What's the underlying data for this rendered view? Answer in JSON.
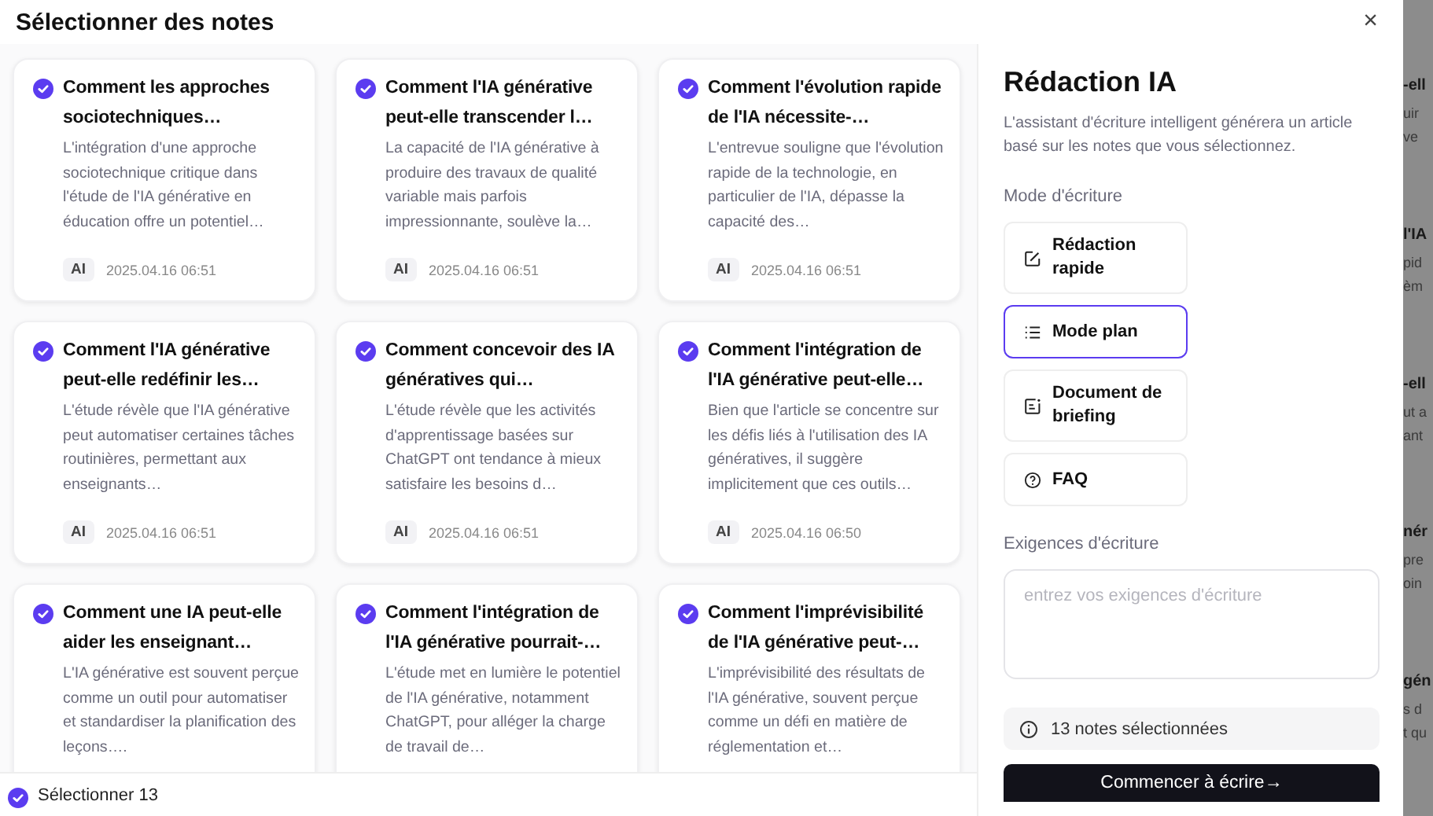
{
  "dialog": {
    "title": "Sélectionner des notes",
    "close": "×"
  },
  "notes": [
    {
      "selected": true,
      "title": "Comment les approches sociotechniques…",
      "summary": "L'intégration d'une approche sociotechnique critique dans l'étude de l'IA générative en éducation offre un potentiel…",
      "tag": "AI",
      "date": "2025.04.16 06:51"
    },
    {
      "selected": true,
      "title": "Comment l'IA générative peut-elle transcender l…",
      "summary": "La capacité de l'IA générative à produire des travaux de qualité variable mais parfois impressionnante, soulève la…",
      "tag": "AI",
      "date": "2025.04.16 06:51"
    },
    {
      "selected": true,
      "title": "Comment l'évolution rapide de l'IA nécessite-…",
      "summary": "L'entrevue souligne que l'évolution rapide de la technologie, en particulier de l'IA, dépasse la capacité des…",
      "tag": "AI",
      "date": "2025.04.16 06:51"
    },
    {
      "selected": true,
      "title": "Comment l'IA générative peut-elle redéfinir les…",
      "summary": "L'étude révèle que l'IA générative peut automatiser certaines tâches routinières, permettant aux enseignants…",
      "tag": "AI",
      "date": "2025.04.16 06:51"
    },
    {
      "selected": true,
      "title": "Comment concevoir des IA génératives qui…",
      "summary": "L'étude révèle que les activités d'apprentissage basées sur ChatGPT ont tendance à mieux satisfaire les besoins d…",
      "tag": "AI",
      "date": "2025.04.16 06:51"
    },
    {
      "selected": true,
      "title": "Comment l'intégration de l'IA générative peut-elle…",
      "summary": "Bien que l'article se concentre sur les défis liés à l'utilisation des IA génératives, il suggère implicitement que ces outils…",
      "tag": "AI",
      "date": "2025.04.16 06:50"
    },
    {
      "selected": true,
      "title": "Comment une IA peut-elle aider les enseignant…",
      "summary": "L'IA générative est souvent perçue comme un outil pour automatiser et standardiser la planification des leçons…."
    },
    {
      "selected": true,
      "title": "Comment l'intégration de l'IA générative pourrait-…",
      "summary": "L'étude met en lumière le potentiel de l'IA générative, notamment ChatGPT, pour alléger la charge de travail de…"
    },
    {
      "selected": true,
      "title": "Comment l'imprévisibilité de l'IA générative peut-…",
      "summary": "L'imprévisibilité des résultats de l'IA générative, souvent perçue comme un défi en matière de réglementation et…"
    }
  ],
  "footer": {
    "select_all": {
      "checked": true,
      "label": "Sélectionner 13"
    }
  },
  "panel": {
    "title": "Rédaction IA",
    "description": "L'assistant d'écriture intelligent générera un article basé sur les notes que vous sélectionnez.",
    "mode_label": "Mode d'écriture",
    "modes": [
      {
        "kind": "quick",
        "label": "Rédaction rapide",
        "selected": false
      },
      {
        "kind": "outline",
        "label": "Mode plan",
        "selected": true
      },
      {
        "kind": "briefing",
        "label": "Document de briefing",
        "selected": false
      },
      {
        "kind": "faq",
        "label": "FAQ",
        "selected": false
      }
    ],
    "requirements_label": "Exigences d'écriture",
    "requirements": {
      "placeholder": "entrez vos exigences d'écriture"
    },
    "info": "13 notes sélectionnées",
    "start_button": "Commencer à écrire→"
  },
  "background_fragments": [
    {
      "lines": [
        "-ell",
        "uir",
        "ve"
      ]
    },
    {
      "lines": [
        "l'IA",
        "pid",
        "èm"
      ]
    },
    {
      "lines": [
        "-ell",
        "ut a",
        "ant"
      ]
    },
    {
      "lines": [
        "nér",
        "pre",
        "oin"
      ]
    },
    {
      "lines": [
        "gén",
        "s d",
        "t qu"
      ]
    }
  ]
}
